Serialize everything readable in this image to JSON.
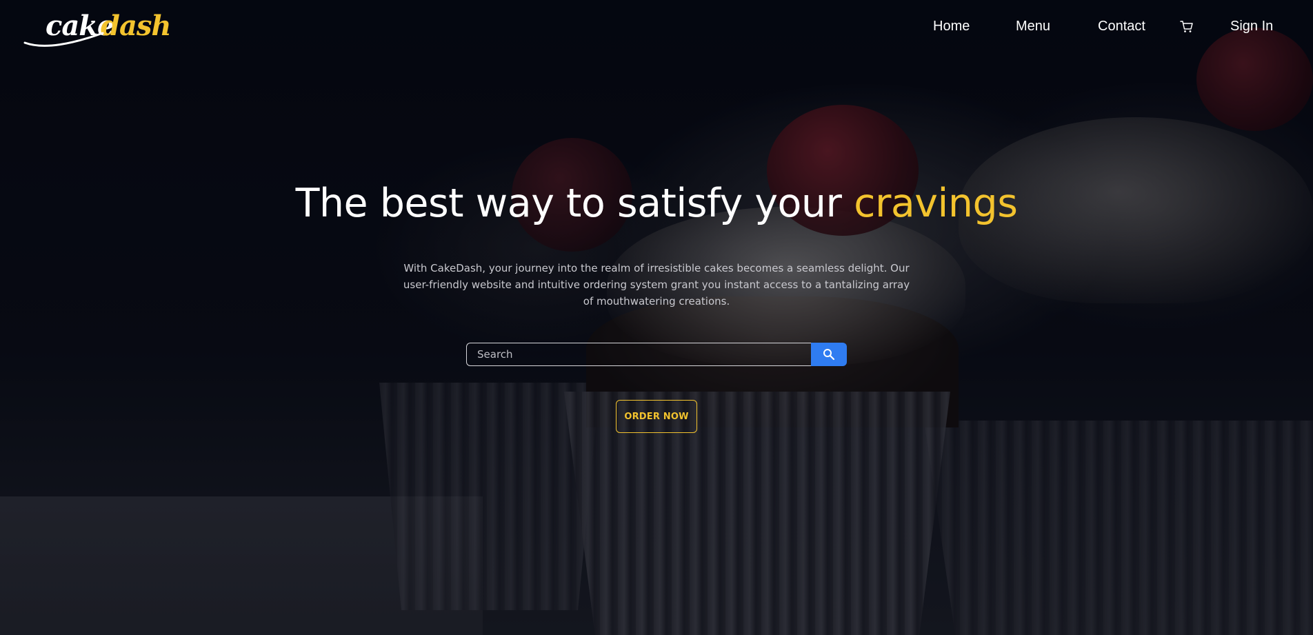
{
  "brand": {
    "logo_part1": "cake",
    "logo_part2": "dash",
    "accent_color": "#f3c32e"
  },
  "nav": {
    "items": [
      {
        "label": "Home"
      },
      {
        "label": "Menu"
      },
      {
        "label": "Contact"
      }
    ],
    "cart_icon": "cart-icon",
    "sign_in_label": "Sign In"
  },
  "hero": {
    "headline_main": "The best way to satisfy your ",
    "headline_accent": "cravings",
    "description": "With CakeDash, your journey into the realm of irresistible cakes becomes a seamless delight. Our user-friendly website and intuitive ordering system grant you instant access to a tantalizing array of mouthwatering creations.",
    "search": {
      "placeholder": "Search",
      "value": "",
      "button_icon": "search-icon",
      "button_color": "#2f7cf1"
    },
    "order_button_label": "ORDER NOW"
  }
}
